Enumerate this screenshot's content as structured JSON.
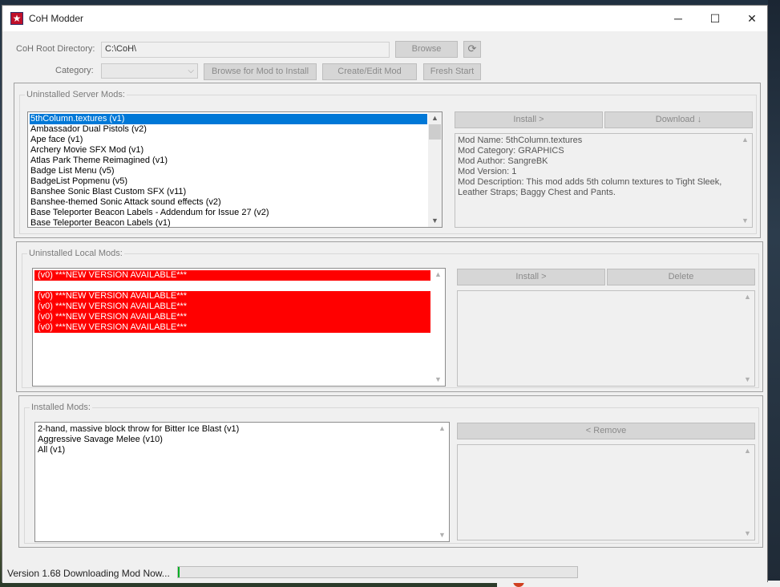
{
  "window": {
    "title": "CoH Modder",
    "controls": {
      "minimize": "─",
      "maximize": "☐",
      "close": "✕"
    }
  },
  "top": {
    "root_label": "CoH Root Directory:",
    "root_value": "C:\\CoH\\",
    "browse_label": "Browse",
    "refresh_icon": "⟳",
    "category_label": "Category:",
    "category_value": "",
    "browse_mod_label": "Browse for Mod to Install",
    "create_edit_label": "Create/Edit Mod",
    "fresh_start_label": "Fresh Start"
  },
  "server": {
    "title": "Uninstalled Server Mods:",
    "install_label": "Install >",
    "download_label": "Download ↓",
    "items": [
      "5thColumn.textures (v1)",
      "Ambassador Dual Pistols (v2)",
      "Ape face (v1)",
      "Archery Movie SFX Mod (v1)",
      "Atlas Park Theme Reimagined (v1)",
      "Badge List Menu (v5)",
      "BadgeList Popmenu (v5)",
      "Banshee Sonic Blast Custom SFX (v11)",
      "Banshee-themed Sonic Attack sound effects (v2)",
      "Base Teleporter Beacon Labels - Addendum for Issue 27 (v2)",
      "Base Teleporter Beacon Labels (v1)"
    ],
    "selected_index": 0,
    "info": {
      "name": "Mod Name: 5thColumn.textures",
      "category": "Mod Category: GRAPHICS",
      "author": "Mod Author: SangreBK",
      "version": "Mod Version: 1",
      "description": "Mod Description: This mod adds 5th column textures to Tight Sleek, Leather Straps; Baggy Chest and Pants."
    }
  },
  "local": {
    "title": "Uninstalled Local Mods:",
    "install_label": "Install >",
    "delete_label": "Delete",
    "items": [
      "(v0) ***NEW VERSION AVAILABLE***",
      "",
      "(v0) ***NEW VERSION AVAILABLE***",
      "(v0) ***NEW VERSION AVAILABLE***",
      "(v0) ***NEW VERSION AVAILABLE***",
      "(v0) ***NEW VERSION AVAILABLE***"
    ]
  },
  "installed": {
    "title": "Installed Mods:",
    "remove_label": "< Remove",
    "items": [
      "2-hand, massive block throw for Bitter Ice Blast (v1)",
      "Aggressive Savage Melee (v10)",
      "All (v1)"
    ]
  },
  "status": {
    "text": "Version 1.68  Downloading Mod Now...",
    "progress": 0.004
  },
  "colors": {
    "selection": "#0078d7",
    "new_version_bg": "#ff0000",
    "progress": "#06b025"
  }
}
